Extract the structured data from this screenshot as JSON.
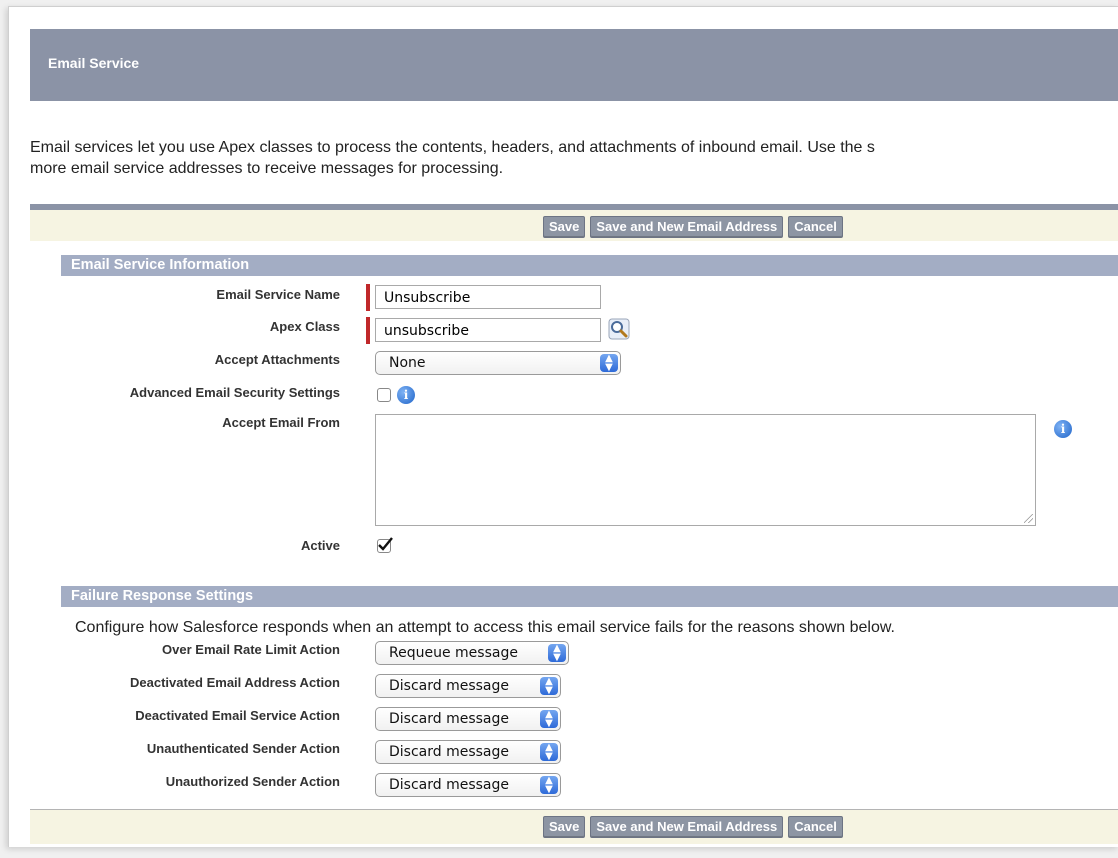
{
  "header": {
    "title": "Email Service"
  },
  "intro": {
    "line1": "Email services let you use Apex classes to process the contents, headers, and attachments of inbound email. Use the s",
    "line2": "more email service addresses to receive messages for processing."
  },
  "buttons": {
    "save": "Save",
    "save_new": "Save and New Email Address",
    "cancel": "Cancel"
  },
  "info_section": {
    "title": "Email Service Information",
    "fields": {
      "name_label": "Email Service Name",
      "name_value": "Unsubscribe",
      "apex_label": "Apex Class",
      "apex_value": "unsubscribe",
      "attach_label": "Accept Attachments",
      "attach_value": "None",
      "security_label": "Advanced Email Security Settings",
      "security_checked": false,
      "from_label": "Accept Email From",
      "from_value": "",
      "active_label": "Active",
      "active_checked": true
    }
  },
  "failure_section": {
    "title": "Failure Response Settings",
    "description": "Configure how Salesforce responds when an attempt to access this email service fails for the reasons shown below.",
    "rows": [
      {
        "label": "Over Email Rate Limit Action",
        "value": "Requeue message"
      },
      {
        "label": "Deactivated Email Address Action",
        "value": "Discard message"
      },
      {
        "label": "Deactivated Email Service Action",
        "value": "Discard message"
      },
      {
        "label": "Unauthenticated Sender Action",
        "value": "Discard message"
      },
      {
        "label": "Unauthorized Sender Action",
        "value": "Discard message"
      }
    ]
  },
  "icons": {
    "lookup": "magnifier-icon",
    "info": "info-icon",
    "select_arrows": "updown-arrows-icon",
    "checkmark": "checkmark-icon"
  },
  "colors": {
    "header_bg": "#8b93a6",
    "section_bg": "#a3adc4",
    "button_bg": "#8d95a3",
    "required": "#c0282a",
    "bar_bg": "#f6f4e2"
  }
}
